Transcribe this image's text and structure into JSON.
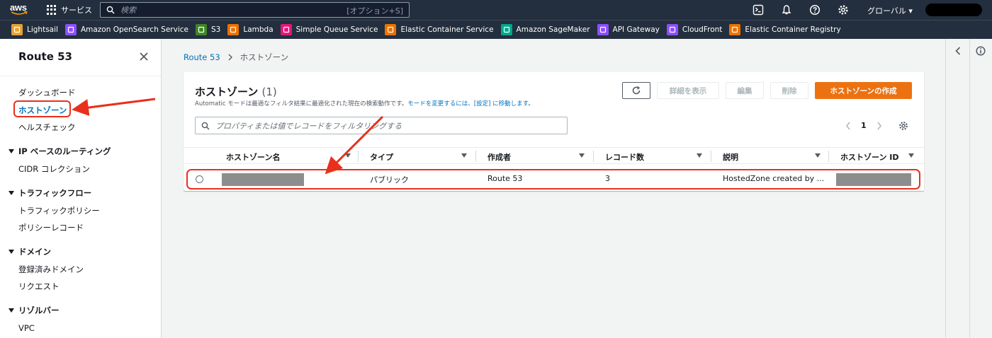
{
  "topnav": {
    "logo": "aws",
    "services_label": "サービス",
    "search_placeholder": "検索",
    "search_shortcut": "[オプション+S]",
    "region_label": "グローバル ▾",
    "icons": [
      "cloudshell-icon",
      "bell-icon",
      "help-icon",
      "gear-icon"
    ]
  },
  "favorites": [
    {
      "label": "Lightsail",
      "color": "#e7a233",
      "icon": "lightsail-icon"
    },
    {
      "label": "Amazon OpenSearch Service",
      "color": "#8c4fff",
      "icon": "opensearch-icon"
    },
    {
      "label": "S3",
      "color": "#3f8624",
      "icon": "s3-icon"
    },
    {
      "label": "Lambda",
      "color": "#ed7100",
      "icon": "lambda-icon"
    },
    {
      "label": "Simple Queue Service",
      "color": "#e7157b",
      "icon": "sqs-icon"
    },
    {
      "label": "Elastic Container Service",
      "color": "#ed7100",
      "icon": "ecs-icon"
    },
    {
      "label": "Amazon SageMaker",
      "color": "#01a88d",
      "icon": "sagemaker-icon"
    },
    {
      "label": "API Gateway",
      "color": "#8c4fff",
      "icon": "apigateway-icon"
    },
    {
      "label": "CloudFront",
      "color": "#8c4fff",
      "icon": "cloudfront-icon"
    },
    {
      "label": "Elastic Container Registry",
      "color": "#ed7100",
      "icon": "ecr-icon"
    }
  ],
  "sidebar": {
    "title": "Route 53",
    "items": {
      "dashboard": "ダッシュボード",
      "hosted_zones": "ホストゾーン",
      "health_checks": "ヘルスチェック",
      "ip_routing": "IP ベースのルーティング",
      "cidr": "CIDR コレクション",
      "traffic_flow": "トラフィックフロー",
      "traffic_policy": "トラフィックポリシー",
      "policy_records": "ポリシーレコード",
      "domains": "ドメイン",
      "registered_domains": "登録済みドメイン",
      "requests": "リクエスト",
      "resolver": "リゾルバー",
      "vpc": "VPC"
    }
  },
  "breadcrumb": {
    "root": "Route 53",
    "current": "ホストゾーン"
  },
  "panel": {
    "title": "ホストゾーン",
    "count": "(1)",
    "desc_prefix": "Automatic モードは最適なフィルタ結果に最適化された現在の検索動作です。",
    "desc_link": "モードを変更するには、[設定] に移動します。",
    "buttons": {
      "details": "詳細を表示",
      "edit": "編集",
      "delete": "削除",
      "create": "ホストゾーンの作成"
    },
    "filter_placeholder": "プロパティまたは値でレコードをフィルタリングする",
    "page": "1"
  },
  "table": {
    "headers": [
      "ホストゾーン名",
      "タイプ",
      "作成者",
      "レコード数",
      "説明",
      "ホストゾーン ID"
    ],
    "rows": [
      {
        "name": "",
        "type": "パブリック",
        "created_by": "Route 53",
        "record_count": "3",
        "description": "HostedZone created by ...",
        "id": ""
      }
    ]
  },
  "annotation_color": "#e8301c"
}
